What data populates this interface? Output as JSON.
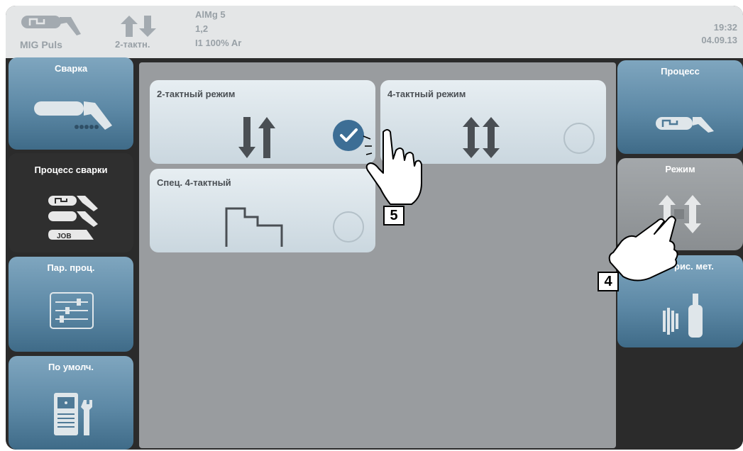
{
  "status": {
    "process": "MIG Puls",
    "mode": "2-тактн.",
    "material": "AlMg 5",
    "wire_diameter": "1,2",
    "gas": "I1 100% Ar",
    "time": "19:32",
    "date": "04.09.13"
  },
  "left_menu": [
    {
      "label": "Сварка",
      "icon": "welding-torch-icon"
    },
    {
      "label": "Процесс сварки",
      "icon": "process-job-icon"
    },
    {
      "label": "Пар. проц.",
      "icon": "sliders-icon"
    },
    {
      "label": "По умолч.",
      "icon": "device-wrench-icon"
    }
  ],
  "options": [
    {
      "label": "2-тактный режим",
      "selected": true
    },
    {
      "label": "4-тактный режим",
      "selected": false
    },
    {
      "label": "Спец. 4-тактный",
      "selected": false
    }
  ],
  "right_menu": [
    {
      "label": "Процесс"
    },
    {
      "label": "Режим"
    },
    {
      "label": "рис. мет."
    }
  ],
  "callouts": {
    "a": "5",
    "b": "4"
  },
  "colors": {
    "accent_blue": "#5d89a6",
    "check_blue": "#3d6e95",
    "dark_bg": "#2b2b2b"
  }
}
